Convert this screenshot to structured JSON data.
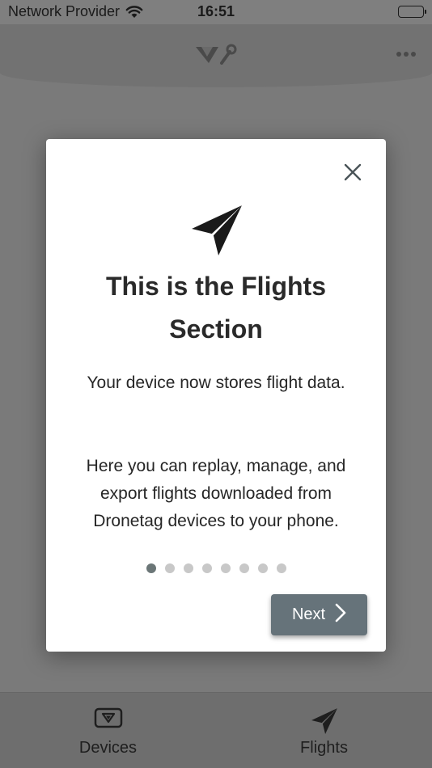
{
  "status_bar": {
    "carrier": "Network Provider",
    "time": "16:51",
    "wifi_icon": "wifi-icon",
    "battery_icon": "battery-icon"
  },
  "header": {
    "logo_icon": "dronetag-logo-icon",
    "menu_icon": "more-horizontal-icon"
  },
  "modal": {
    "icon": "paper-plane-icon",
    "title": "This is the Flights Section",
    "paragraph_1": "Your device now stores flight data.",
    "paragraph_2": "Here you can replay, manage, and export flights downloaded from Dronetag devices to your phone.",
    "pager": {
      "total": 8,
      "active": 1
    },
    "next_label": "Next",
    "close_icon": "close-icon"
  },
  "tabs": [
    {
      "label": "Devices",
      "icon": "device-icon"
    },
    {
      "label": "Flights",
      "icon": "paper-plane-icon"
    }
  ],
  "colors": {
    "overlay_background": "#7a7a7a",
    "modal_background": "#ffffff",
    "next_button": "#66737a",
    "active_dot": "#6b7677",
    "inactive_dot": "#c8c8c8"
  }
}
